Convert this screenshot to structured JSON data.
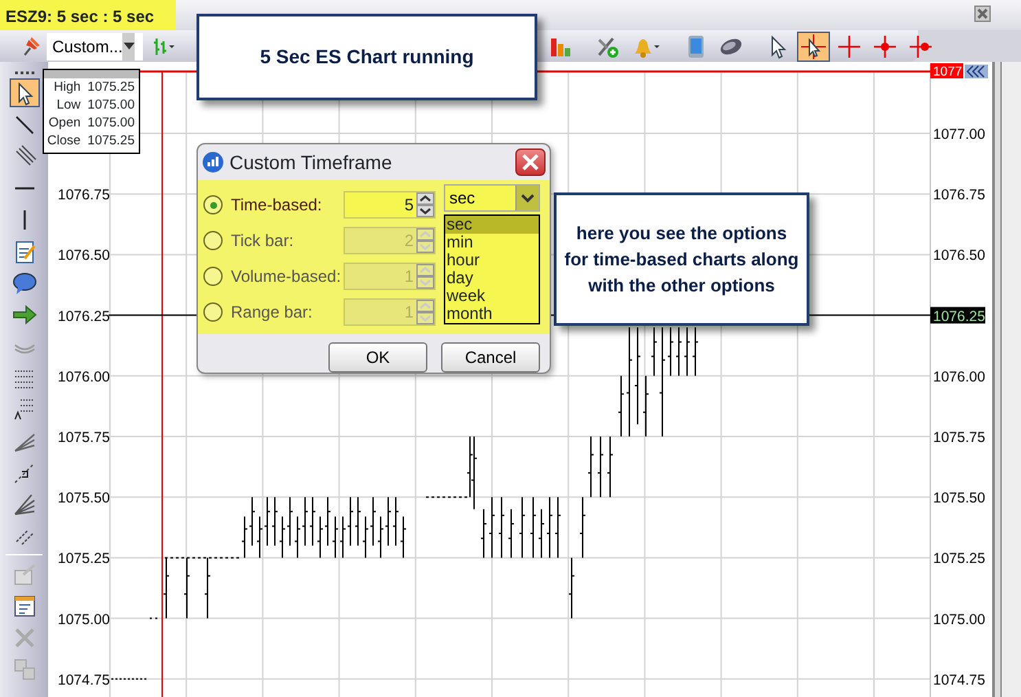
{
  "window": {
    "title": "ESZ9: 5 sec : 5 sec"
  },
  "toolbar": {
    "timeframe": "Custom...",
    "tools": [
      {
        "kind": "bar-type",
        "selected": false
      },
      {
        "kind": "bars",
        "selected": false
      },
      {
        "kind": "indicator-add",
        "selected": false
      },
      {
        "kind": "alert",
        "selected": false
      },
      {
        "kind": "phone",
        "selected": false
      },
      {
        "kind": "mouse",
        "selected": false
      },
      {
        "kind": "pointer",
        "selected": false
      },
      {
        "kind": "crosshair-pointer",
        "selected": true
      },
      {
        "kind": "crosshair",
        "selected": false
      },
      {
        "kind": "crosshair-dot",
        "selected": false
      },
      {
        "kind": "crosshair-dot-right",
        "selected": false
      }
    ]
  },
  "drawing_tools": [
    {
      "kind": "pointer",
      "selected": true
    },
    {
      "kind": "line",
      "selected": false
    },
    {
      "kind": "channel",
      "selected": false
    },
    {
      "kind": "hline",
      "selected": false
    },
    {
      "kind": "vline",
      "selected": false
    },
    {
      "kind": "note",
      "selected": false
    },
    {
      "kind": "bubble",
      "selected": false
    },
    {
      "kind": "arrow",
      "selected": false
    },
    {
      "kind": "arc",
      "selected": false
    },
    {
      "kind": "dots",
      "selected": false
    },
    {
      "kind": "fib",
      "selected": false
    },
    {
      "kind": "fan",
      "selected": false
    },
    {
      "kind": "gann",
      "selected": false
    },
    {
      "kind": "fan2",
      "selected": false
    },
    {
      "kind": "parallel",
      "selected": false
    },
    {
      "kind": "edit",
      "selected": false
    },
    {
      "kind": "table",
      "selected": false
    },
    {
      "kind": "delete",
      "selected": false
    },
    {
      "kind": "copy",
      "selected": false
    }
  ],
  "ohlc": [
    {
      "label": "High",
      "value": "1075.25"
    },
    {
      "label": "Low",
      "value": "1075.00"
    },
    {
      "label": "Open",
      "value": "1075.00"
    },
    {
      "label": "Close",
      "value": "1075.25"
    }
  ],
  "price_axis": {
    "top_marker": "1077",
    "labels": [
      {
        "text": "1077.00",
        "highlighted": false
      },
      {
        "text": "1076.75",
        "highlighted": false
      },
      {
        "text": "1076.50",
        "highlighted": false
      },
      {
        "text": "1076.25",
        "highlighted": true
      },
      {
        "text": "1076.00",
        "highlighted": false
      },
      {
        "text": "1075.75",
        "highlighted": false
      },
      {
        "text": "1075.50",
        "highlighted": false
      },
      {
        "text": "1075.25",
        "highlighted": false
      },
      {
        "text": "1075.00",
        "highlighted": false
      },
      {
        "text": "1074.75",
        "highlighted": false
      }
    ]
  },
  "left_axis_labels": [
    "1076.75",
    "1076.50",
    "1076.25",
    "1076.00",
    "1075.75",
    "1075.50",
    "1075.25",
    "1075.00",
    "1074.75"
  ],
  "dialog": {
    "title": "Custom Timeframe",
    "options": [
      {
        "label": "Time-based:",
        "value": "5",
        "selected": true,
        "disabled": false
      },
      {
        "label": "Tick bar:",
        "value": "2",
        "selected": false,
        "disabled": true
      },
      {
        "label": "Volume-based:",
        "value": "1",
        "selected": false,
        "disabled": true
      },
      {
        "label": "Range bar:",
        "value": "1",
        "selected": false,
        "disabled": true
      }
    ],
    "unit": {
      "value": "sec",
      "options": [
        {
          "label": "sec",
          "selected": true
        },
        {
          "label": "min",
          "selected": false
        },
        {
          "label": "hour",
          "selected": false
        },
        {
          "label": "day",
          "selected": false
        },
        {
          "label": "week",
          "selected": false
        },
        {
          "label": "month",
          "selected": false
        }
      ]
    },
    "buttons": [
      "OK",
      "Cancel"
    ]
  },
  "callouts": [
    "5 Sec ES Chart running",
    "here you see the options for time-based charts along with the other options"
  ]
}
